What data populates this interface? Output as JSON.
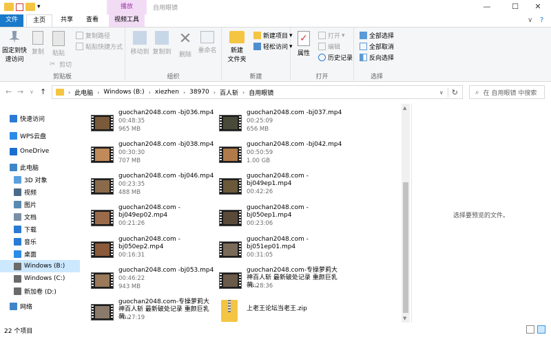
{
  "titlebar": {
    "title": "自用眼镜",
    "play_tab": "播放",
    "minimize": "—",
    "maximize": "☐",
    "close": "✕"
  },
  "tabs": {
    "file": "文件",
    "home": "主页",
    "share": "共享",
    "view": "查看",
    "video_tools": "视频工具",
    "collapse": "∨",
    "help": "?"
  },
  "ribbon": {
    "clipboard": {
      "label": "剪贴板",
      "pin": "固定到快",
      "pin2": "速访问",
      "copy": "复制",
      "paste": "粘贴",
      "copy_path": "复制路径",
      "paste_shortcut": "粘贴快捷方式",
      "cut": "剪切"
    },
    "organize": {
      "label": "组织",
      "move_to": "移动到",
      "copy_to": "复制到",
      "delete": "删除",
      "rename": "重命名"
    },
    "new": {
      "label": "新建",
      "new_folder": "新建",
      "new_folder2": "文件夹",
      "new_item": "新建项目",
      "easy_access": "轻松访问"
    },
    "open": {
      "label": "打开",
      "properties": "属性",
      "open": "打开",
      "edit": "编辑",
      "history": "历史记录"
    },
    "select": {
      "label": "选择",
      "select_all": "全部选择",
      "select_none": "全部取消",
      "invert": "反向选择"
    }
  },
  "address": {
    "back": "←",
    "forward": "→",
    "recent": "∨",
    "up": "↑",
    "crumbs": [
      "此电脑",
      "Windows (B:)",
      "xiezhen",
      "38970",
      "百人斩",
      "自用眼镜"
    ],
    "dropdown": "∨",
    "refresh": "↻",
    "search_placeholder": "在 自用眼镜 中搜索"
  },
  "nav": {
    "items": [
      {
        "label": "快速访问",
        "icon": "star-icon",
        "color": "#2a7ad6"
      },
      {
        "label": "WPS云盘",
        "icon": "cloud-icon",
        "color": "#2b8be8"
      },
      {
        "label": "OneDrive",
        "icon": "cloud-icon",
        "color": "#1a6fd1"
      },
      {
        "label": "此电脑",
        "icon": "computer-icon",
        "color": "#3f86c8"
      },
      {
        "label": "3D 对象",
        "icon": "cube-icon",
        "color": "#5aa0e0"
      },
      {
        "label": "视频",
        "icon": "video-icon",
        "color": "#4a6a8a"
      },
      {
        "label": "图片",
        "icon": "picture-icon",
        "color": "#5a8ab0"
      },
      {
        "label": "文档",
        "icon": "document-icon",
        "color": "#7a8fa6"
      },
      {
        "label": "下载",
        "icon": "download-icon",
        "color": "#2a7ad6"
      },
      {
        "label": "音乐",
        "icon": "music-icon",
        "color": "#2a7ad6"
      },
      {
        "label": "桌面",
        "icon": "desktop-icon",
        "color": "#2b8be8"
      },
      {
        "label": "Windows (B:)",
        "icon": "drive-icon",
        "color": "#6a6a6a"
      },
      {
        "label": "Windows (C:)",
        "icon": "drive-icon",
        "color": "#6a6a6a"
      },
      {
        "label": "新加卷 (D:)",
        "icon": "drive-icon",
        "color": "#6a6a6a"
      },
      {
        "label": "网络",
        "icon": "network-icon",
        "color": "#3f86c8"
      }
    ]
  },
  "files": [
    {
      "name": "guochan2048.com -bj036.mp4",
      "duration": "00:48:35",
      "size": "965 MB"
    },
    {
      "name": "guochan2048.com -bj037.mp4",
      "duration": "00:25:09",
      "size": "656 MB"
    },
    {
      "name": "guochan2048.com -bj038.mp4",
      "duration": "00:30:30",
      "size": "707 MB"
    },
    {
      "name": "guochan2048.com -bj042.mp4",
      "duration": "00:50:59",
      "size": "1.00 GB"
    },
    {
      "name": "guochan2048.com -bj046.mp4",
      "duration": "00:23:35",
      "size": "488 MB"
    },
    {
      "name": "guochan2048.com -bj049ep1.mp4",
      "duration": "00:42:26",
      "size": ""
    },
    {
      "name": "guochan2048.com -bj049ep02.mp4",
      "duration": "00:21:26",
      "size": ""
    },
    {
      "name": "guochan2048.com -bj050ep1.mp4",
      "duration": "00:23:06",
      "size": ""
    },
    {
      "name": "guochan2048.com -bj050ep2.mp4",
      "duration": "00:16:31",
      "size": ""
    },
    {
      "name": "guochan2048.com -bj051ep01.mp4",
      "duration": "00:31:05",
      "size": ""
    },
    {
      "name": "guochan2048.com -bj053.mp4",
      "duration": "00:46:22",
      "size": "943 MB"
    },
    {
      "name": "guochan2048.com-专操萝莉大神百人斩 最新破处记录 重颜巨乳萌...",
      "duration": "00:28:36",
      "size": ""
    },
    {
      "name": "guochan2048.com-专操萝莉大神百人斩 最新破处记录 重颜巨乳萌...",
      "duration": "00:27:19",
      "size": ""
    },
    {
      "name": "上老王论坛当老王.zip",
      "duration": "",
      "size": ""
    }
  ],
  "preview": {
    "text": "选择要预览的文件。"
  },
  "status": {
    "count": "22 个项目"
  }
}
